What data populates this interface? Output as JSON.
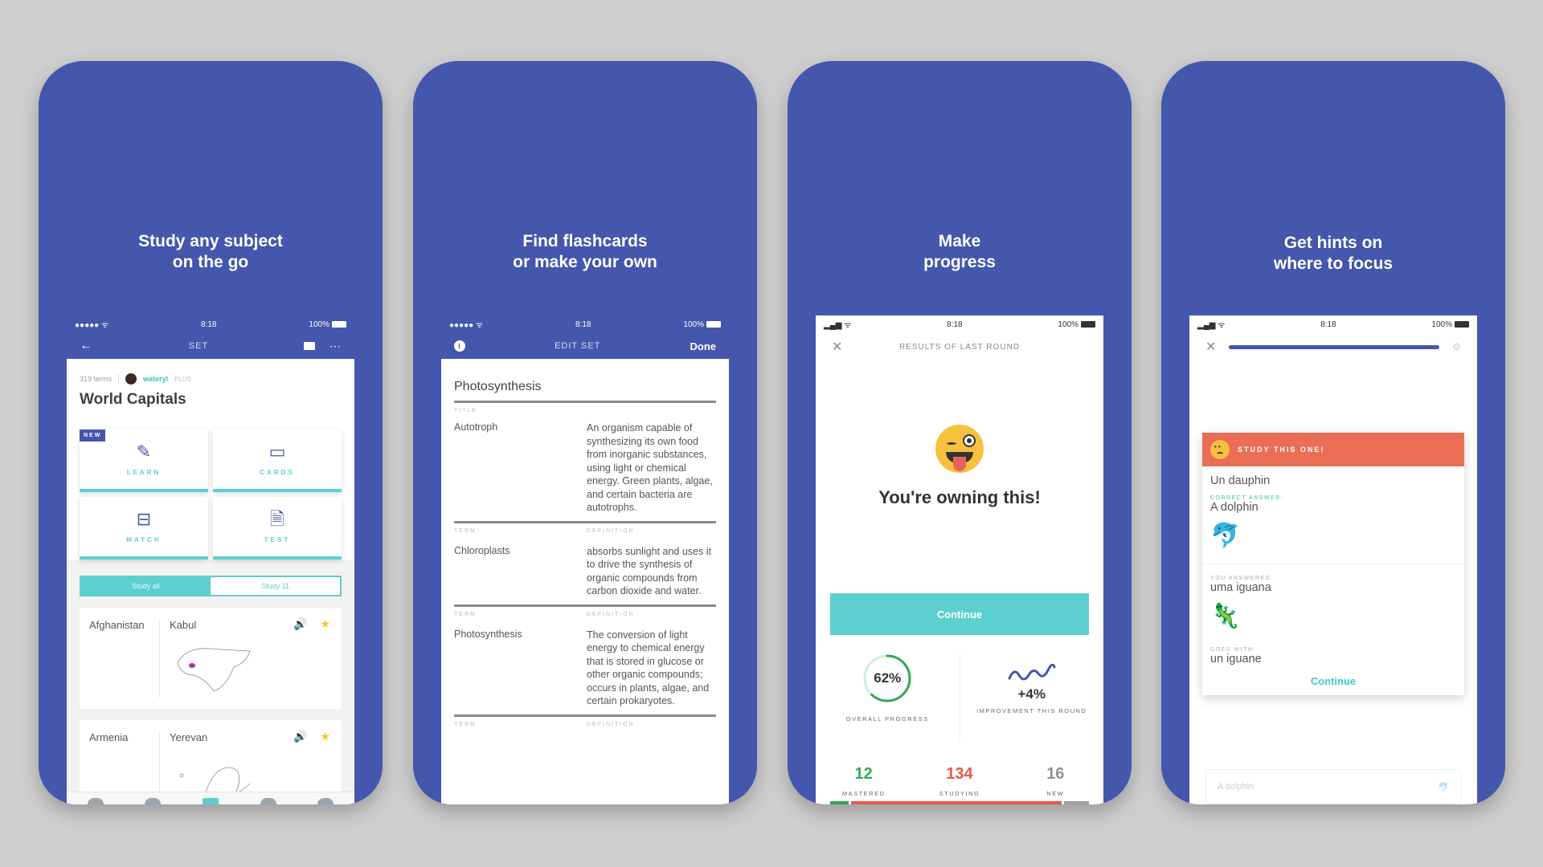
{
  "colors": {
    "brand_blue": "#4556ad",
    "teal": "#5ccfcf",
    "mastered_green": "#34a853",
    "studying_red": "#e8584a",
    "new_gray": "#8a9199",
    "hint_orange": "#ea6d55",
    "star_yellow": "#f5c518"
  },
  "status": {
    "time": "8:18",
    "battery": "100%"
  },
  "panels": [
    {
      "headline": [
        "Study any subject",
        "on the go"
      ],
      "nav_title": "SET",
      "meta": {
        "terms": "319 terms",
        "user": "wateryl",
        "badge": "PLUS"
      },
      "set_title": "World Capitals",
      "new_badge": "NEW",
      "modes": [
        {
          "label": "LEARN",
          "icon": "pencil-icon"
        },
        {
          "label": "CARDS",
          "icon": "cards-icon"
        },
        {
          "label": "MATCH",
          "icon": "match-icon"
        },
        {
          "label": "TEST",
          "icon": "test-document-icon"
        }
      ],
      "study_toggle": {
        "all": "Study all",
        "starred": "Study 11"
      },
      "terms": [
        {
          "term": "Afghanistan",
          "definition": "Kabul",
          "starred": true
        },
        {
          "term": "Armenia",
          "definition": "Yerevan",
          "starred": true
        }
      ]
    },
    {
      "headline": [
        "Find flashcards",
        "or make your own"
      ],
      "nav_title": "EDIT SET",
      "done_label": "Done",
      "set_title": "Photosynthesis",
      "title_label": "TITLE",
      "term_label": "TERM",
      "definition_label": "DEFINITION",
      "cards": [
        {
          "term": "Autotroph",
          "definition": "An organism capable of synthesizing its own food from inorganic substances, using light or chemical energy. Green plants, algae, and certain bacteria are autotrophs."
        },
        {
          "term": "Chloroplasts",
          "definition": "absorbs sunlight and uses it to drive the synthesis of organic compounds from carbon dioxide and water."
        },
        {
          "term": "Photosynthesis",
          "definition": "The conversion of light energy to chemical energy that is stored in glucose or other organic compounds; occurs in plants, algae, and certain prokaryotes."
        }
      ]
    },
    {
      "headline": [
        "Make",
        "progress"
      ],
      "nav_title": "RESULTS OF LAST ROUND",
      "message": "You're owning this!",
      "continue_label": "Continue",
      "overall_progress": {
        "value": "62%",
        "fraction": 0.62,
        "label": "OVERALL PROGRESS"
      },
      "improvement": {
        "value": "+4%",
        "label": "IMPROVEMENT THIS ROUND"
      },
      "counts": [
        {
          "value": "12",
          "label": "MASTERED"
        },
        {
          "value": "134",
          "label": "STUDYING"
        },
        {
          "value": "16",
          "label": "NEW"
        }
      ]
    },
    {
      "headline": [
        "Get hints on",
        "where to focus"
      ],
      "progress_fraction": 1.0,
      "banner": "STUDY THIS ONE!",
      "prompt": "Un dauphin",
      "correct_label": "CORRECT ANSWER:",
      "correct": "A dolphin",
      "answered_label": "YOU ANSWERED:",
      "answered": "uma iguana",
      "goes_with_label": "GOES WITH:",
      "goes_with": "un iguane",
      "continue_label": "Continue",
      "ghost_text": "A dolphin"
    }
  ]
}
